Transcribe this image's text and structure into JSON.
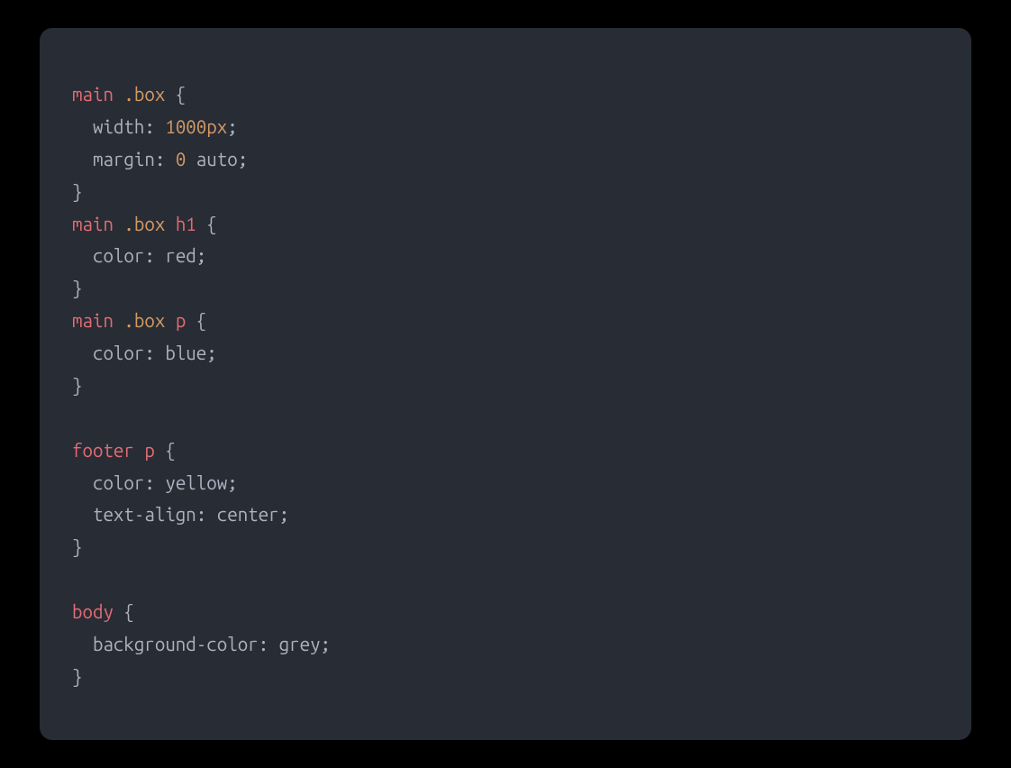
{
  "code": {
    "lines": [
      [
        {
          "t": "main",
          "c": "tok-tag"
        },
        {
          "t": " ",
          "c": "tok-punct"
        },
        {
          "t": ".box",
          "c": "tok-class"
        },
        {
          "t": " {",
          "c": "tok-punct"
        }
      ],
      [
        {
          "t": "  ",
          "c": "tok-punct"
        },
        {
          "t": "width",
          "c": "tok-prop"
        },
        {
          "t": ": ",
          "c": "tok-punct"
        },
        {
          "t": "1000px",
          "c": "tok-num"
        },
        {
          "t": ";",
          "c": "tok-punct"
        }
      ],
      [
        {
          "t": "  ",
          "c": "tok-punct"
        },
        {
          "t": "margin",
          "c": "tok-prop"
        },
        {
          "t": ": ",
          "c": "tok-punct"
        },
        {
          "t": "0",
          "c": "tok-num"
        },
        {
          "t": " auto;",
          "c": "tok-punct"
        }
      ],
      [
        {
          "t": "}",
          "c": "tok-punct"
        }
      ],
      [
        {
          "t": "main",
          "c": "tok-tag"
        },
        {
          "t": " ",
          "c": "tok-punct"
        },
        {
          "t": ".box",
          "c": "tok-class"
        },
        {
          "t": " ",
          "c": "tok-punct"
        },
        {
          "t": "h1",
          "c": "tok-tag"
        },
        {
          "t": " {",
          "c": "tok-punct"
        }
      ],
      [
        {
          "t": "  ",
          "c": "tok-punct"
        },
        {
          "t": "color",
          "c": "tok-prop"
        },
        {
          "t": ": ",
          "c": "tok-punct"
        },
        {
          "t": "red",
          "c": "tok-ident"
        },
        {
          "t": ";",
          "c": "tok-punct"
        }
      ],
      [
        {
          "t": "}",
          "c": "tok-punct"
        }
      ],
      [
        {
          "t": "main",
          "c": "tok-tag"
        },
        {
          "t": " ",
          "c": "tok-punct"
        },
        {
          "t": ".box",
          "c": "tok-class"
        },
        {
          "t": " ",
          "c": "tok-punct"
        },
        {
          "t": "p",
          "c": "tok-tag"
        },
        {
          "t": " {",
          "c": "tok-punct"
        }
      ],
      [
        {
          "t": "  ",
          "c": "tok-punct"
        },
        {
          "t": "color",
          "c": "tok-prop"
        },
        {
          "t": ": ",
          "c": "tok-punct"
        },
        {
          "t": "blue",
          "c": "tok-ident"
        },
        {
          "t": ";",
          "c": "tok-punct"
        }
      ],
      [
        {
          "t": "}",
          "c": "tok-punct"
        }
      ],
      [
        {
          "t": "",
          "c": "tok-punct"
        }
      ],
      [
        {
          "t": "footer",
          "c": "tok-tag"
        },
        {
          "t": " ",
          "c": "tok-punct"
        },
        {
          "t": "p",
          "c": "tok-tag"
        },
        {
          "t": " {",
          "c": "tok-punct"
        }
      ],
      [
        {
          "t": "  ",
          "c": "tok-punct"
        },
        {
          "t": "color",
          "c": "tok-prop"
        },
        {
          "t": ": ",
          "c": "tok-punct"
        },
        {
          "t": "yellow",
          "c": "tok-ident"
        },
        {
          "t": ";",
          "c": "tok-punct"
        }
      ],
      [
        {
          "t": "  ",
          "c": "tok-punct"
        },
        {
          "t": "text-align",
          "c": "tok-prop"
        },
        {
          "t": ": center;",
          "c": "tok-punct"
        }
      ],
      [
        {
          "t": "}",
          "c": "tok-punct"
        }
      ],
      [
        {
          "t": "",
          "c": "tok-punct"
        }
      ],
      [
        {
          "t": "body",
          "c": "tok-tag"
        },
        {
          "t": " {",
          "c": "tok-punct"
        }
      ],
      [
        {
          "t": "  ",
          "c": "tok-punct"
        },
        {
          "t": "background-color",
          "c": "tok-prop"
        },
        {
          "t": ": ",
          "c": "tok-punct"
        },
        {
          "t": "grey",
          "c": "tok-ident"
        },
        {
          "t": ";",
          "c": "tok-punct"
        }
      ],
      [
        {
          "t": "}",
          "c": "tok-punct"
        }
      ]
    ]
  }
}
